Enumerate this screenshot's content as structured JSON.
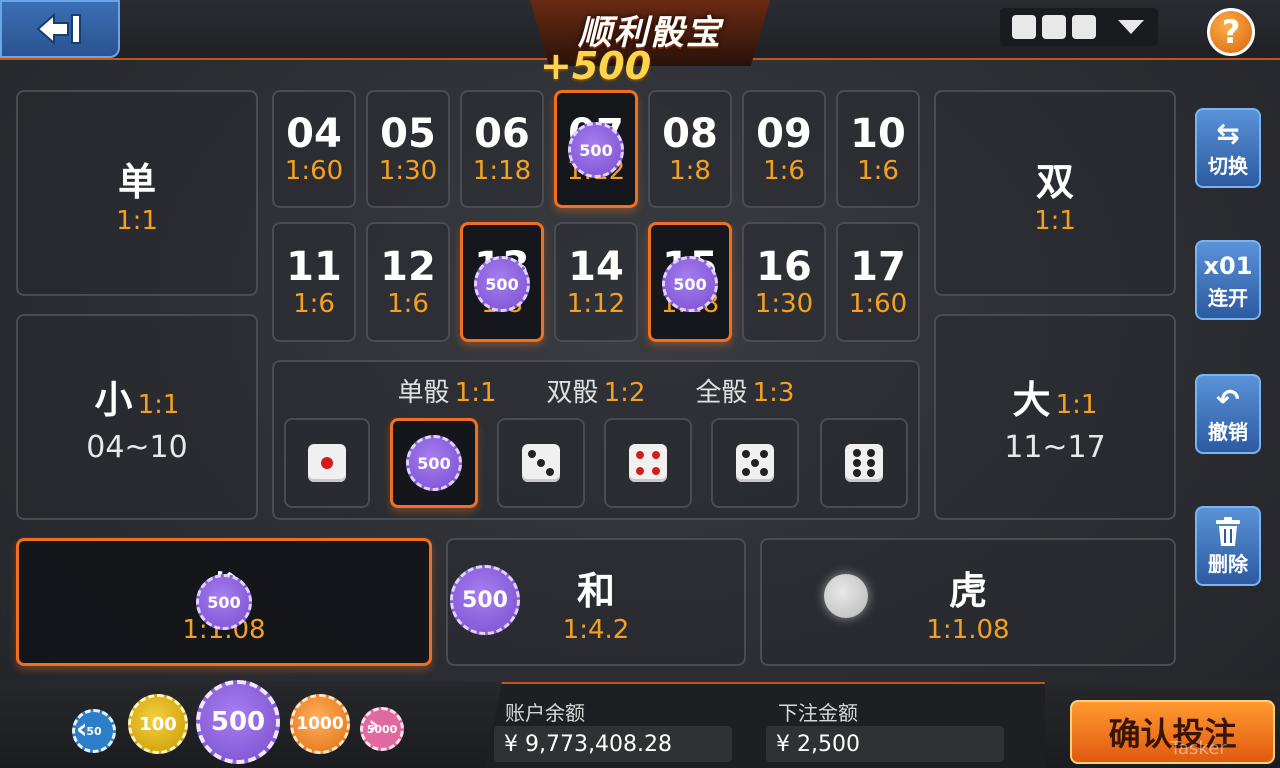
{
  "header": {
    "title": "顺利骰宝",
    "win_popup": "+500",
    "help_icon": "?"
  },
  "grid": {
    "row1": [
      {
        "num": "04",
        "odds": "1:60",
        "chip": null
      },
      {
        "num": "05",
        "odds": "1:30",
        "chip": null
      },
      {
        "num": "06",
        "odds": "1:18",
        "chip": null
      },
      {
        "num": "07",
        "odds": "1:12",
        "chip": "500"
      },
      {
        "num": "08",
        "odds": "1:8",
        "chip": null
      },
      {
        "num": "09",
        "odds": "1:6",
        "chip": null
      },
      {
        "num": "10",
        "odds": "1:6",
        "chip": null
      }
    ],
    "row2": [
      {
        "num": "11",
        "odds": "1:6",
        "chip": null
      },
      {
        "num": "12",
        "odds": "1:6",
        "chip": null
      },
      {
        "num": "13",
        "odds": "1:8",
        "chip": "500"
      },
      {
        "num": "14",
        "odds": "1:12",
        "chip": null
      },
      {
        "num": "15",
        "odds": "1:18",
        "chip": "500"
      },
      {
        "num": "16",
        "odds": "1:30",
        "chip": null
      },
      {
        "num": "17",
        "odds": "1:60",
        "chip": null
      }
    ]
  },
  "bets": {
    "odd": {
      "label": "单",
      "odds": "1:1"
    },
    "even": {
      "label": "双",
      "odds": "1:1"
    },
    "small": {
      "label": "小",
      "odds": "1:1",
      "range": "04~10"
    },
    "big": {
      "label": "大",
      "odds": "1:1",
      "range": "11~17"
    }
  },
  "dice_section": {
    "single": {
      "label": "单骰",
      "odds": "1:1"
    },
    "double": {
      "label": "双骰",
      "odds": "1:2"
    },
    "triple": {
      "label": "全骰",
      "odds": "1:3"
    },
    "faces": [
      1,
      2,
      3,
      4,
      5,
      6
    ],
    "selected_face": 2,
    "selected_chip": "500"
  },
  "dragon_tiger": {
    "dragon": {
      "label": "龙",
      "odds": "1:1.08",
      "chip": "500"
    },
    "tie": {
      "label": "和",
      "odds": "1:4.2",
      "chip": "500"
    },
    "tiger": {
      "label": "虎",
      "odds": "1:1.08"
    }
  },
  "side_buttons": [
    {
      "label": "切换",
      "icon": "switch-icon",
      "glyph": "⇆"
    },
    {
      "label": "连开",
      "icon": "multiplier-icon",
      "glyph": "x01"
    },
    {
      "label": "撤销",
      "icon": "undo-icon",
      "glyph": "↶"
    },
    {
      "label": "删除",
      "icon": "trash-icon",
      "glyph": "🗑"
    }
  ],
  "chips": [
    {
      "value": "50",
      "color": "#2a7fc8"
    },
    {
      "value": "100",
      "color": "#e0b010"
    },
    {
      "value": "500",
      "color": "#8a5ee0"
    },
    {
      "value": "1000",
      "color": "#f09020"
    },
    {
      "value": "5000",
      "color": "#e06aa0"
    }
  ],
  "account": {
    "balance_label": "账户余额",
    "balance_value": "¥ 9,773,408.28",
    "bet_label": "下注金额",
    "bet_value": "¥ 2,500"
  },
  "confirm_label": "确认投注",
  "watermark": "Tasker",
  "colors": {
    "accent": "#f07020",
    "odds": "#f4a020",
    "chip_purple": "#8a5ee0",
    "button_blue": "#3d74c0"
  }
}
